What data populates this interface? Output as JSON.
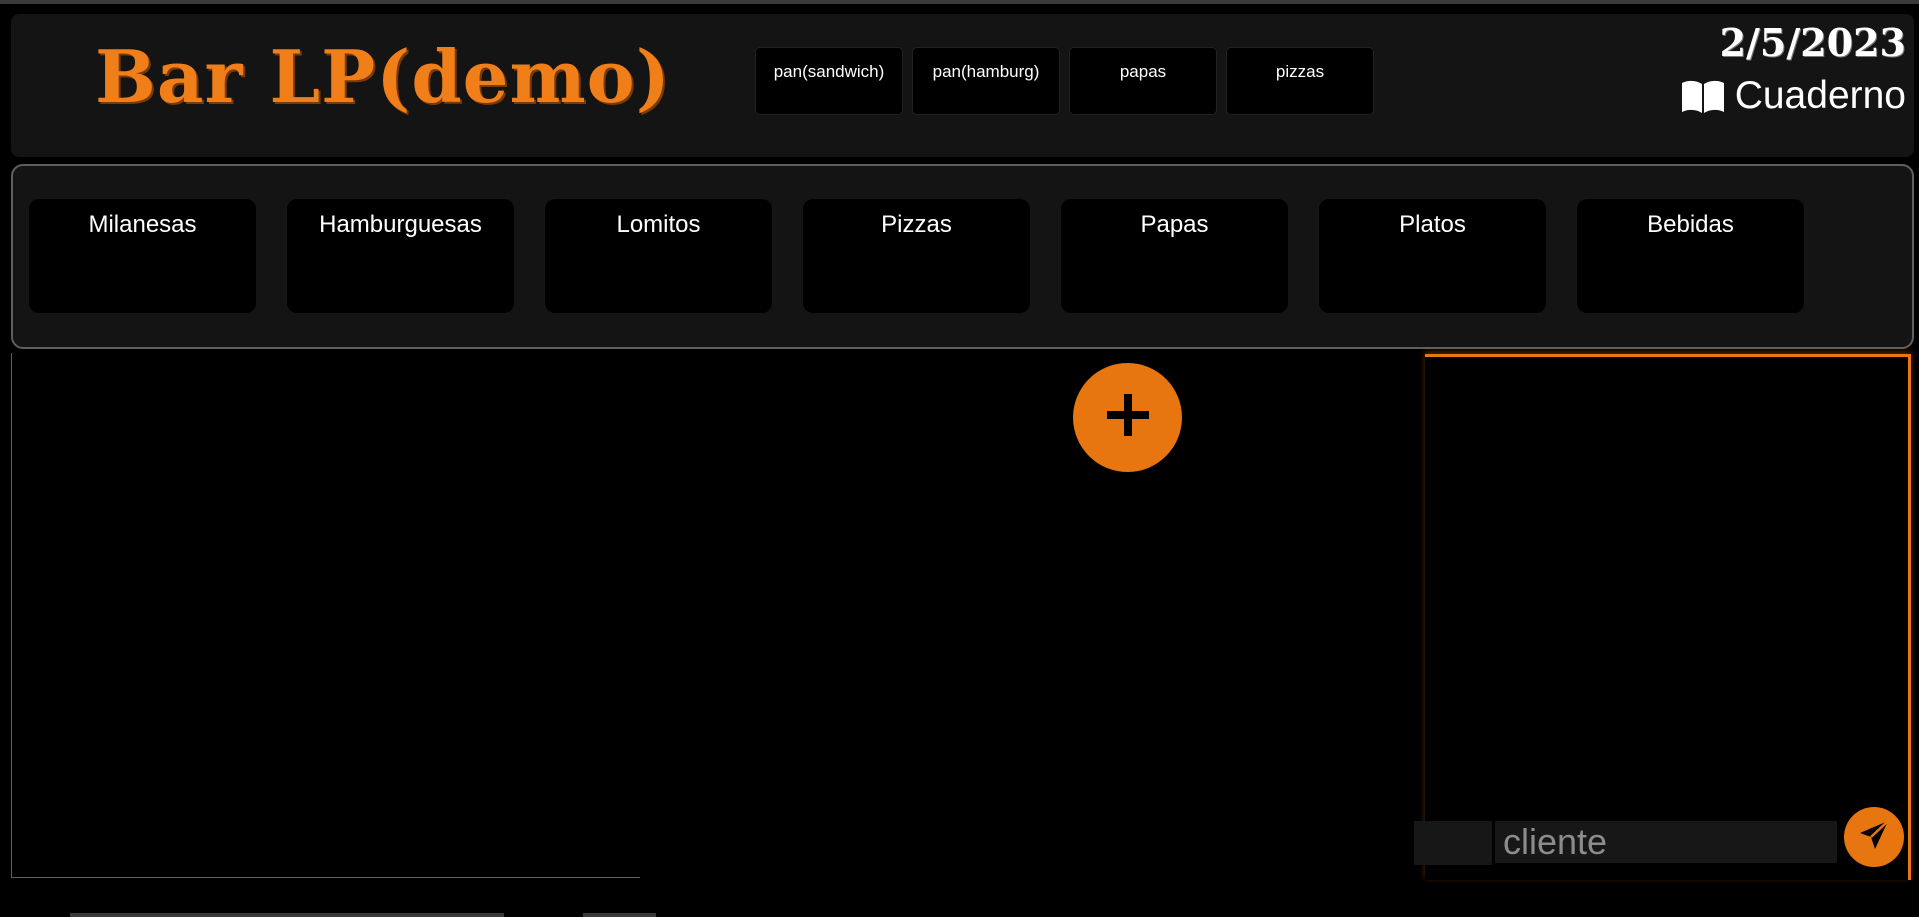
{
  "header": {
    "title": "Bar LP(demo)",
    "date": "2/5/2023",
    "notebook_label": "Cuaderno",
    "notebook_icon": "book-icon",
    "quick_buttons": [
      "pan(sandwich)",
      "pan(hamburg)",
      "papas",
      "pizzas"
    ]
  },
  "categories": [
    "Milanesas",
    "Hamburguesas",
    "Lomitos",
    "Pizzas",
    "Papas",
    "Platos",
    "Bebidas"
  ],
  "order": {
    "add_icon": "plus-icon",
    "client_placeholder": "cliente",
    "table_value": "",
    "send_icon": "send-icon"
  },
  "colors": {
    "accent": "#e87610",
    "background": "#000000",
    "panel": "#141414"
  }
}
